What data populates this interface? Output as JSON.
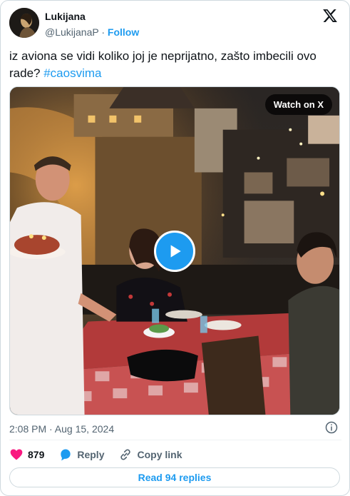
{
  "author": {
    "name": "Lukijana",
    "handle": "@LukijanaP",
    "separator": "·",
    "follow_label": "Follow"
  },
  "tweet": {
    "text": "iz aviona se vidi koliko joj je neprijatno, zašto imbecili ovo rade? ",
    "hashtag": "#caosvima"
  },
  "media": {
    "watch_label": "Watch on X"
  },
  "timestamp": "2:08 PM · Aug 15, 2024",
  "actions": {
    "like_count": "879",
    "reply_label": "Reply",
    "copy_link_label": "Copy link"
  },
  "read_replies_label": "Read 94 replies",
  "colors": {
    "accent": "#1d9bf0",
    "like": "#f91880",
    "text": "#0f1419",
    "secondary": "#536471"
  }
}
